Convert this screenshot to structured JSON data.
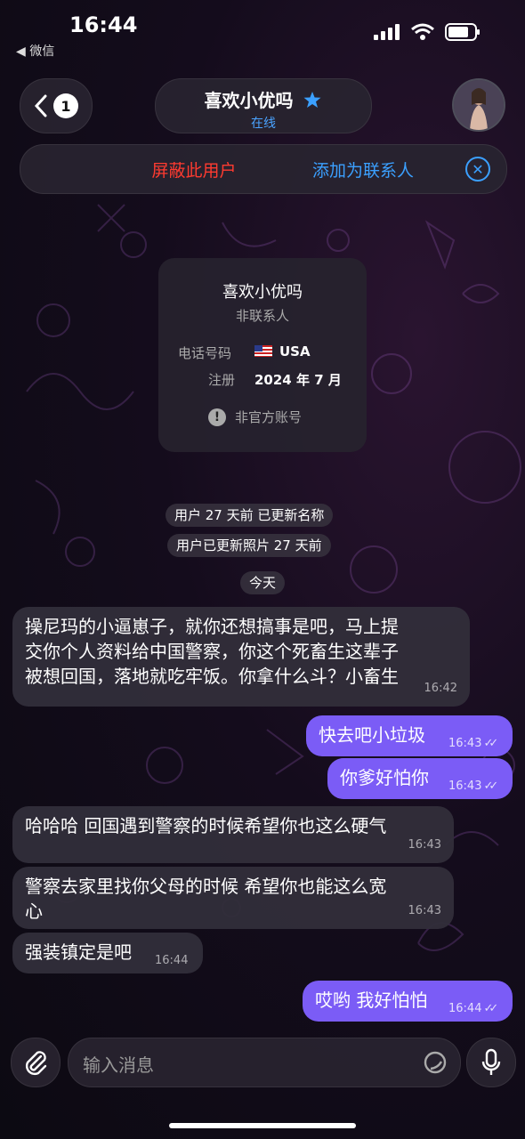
{
  "status_bar": {
    "time": "16:44",
    "back_app": "◀ 微信"
  },
  "header": {
    "back_badge": "1",
    "name": "喜欢小优吗",
    "status": "在线"
  },
  "action_bar": {
    "block": "屏蔽此用户",
    "add_contact": "添加为联系人"
  },
  "info_card": {
    "name": "喜欢小优吗",
    "subtitle": "非联系人",
    "phone_label": "电话号码",
    "phone_value": "USA",
    "registered_label": "注册",
    "registered_value": "2024 年 7 月",
    "unofficial": "非官方账号"
  },
  "system_messages": {
    "name_updated": "用户 27 天前 已更新名称",
    "photo_updated": "用户已更新照片 27 天前",
    "today": "今天"
  },
  "messages": [
    {
      "direction": "in",
      "lines": [
        "操尼玛的小逼崽子，就你还想搞事是吧，马上提",
        "交你个人资料给中国警察，你这个死畜生这辈子",
        "被想回国，落地就吃牢饭。你拿什么斗？小畜生"
      ],
      "time": "16:42"
    },
    {
      "direction": "out",
      "text": "快去吧小垃圾",
      "time": "16:43"
    },
    {
      "direction": "out",
      "text": "你爹好怕你",
      "time": "16:43"
    },
    {
      "direction": "in",
      "text": "哈哈哈 回国遇到警察的时候希望你也这么硬气",
      "time": "16:43"
    },
    {
      "direction": "in",
      "lines": [
        "警察去家里找你父母的时候 希望你也能这么宽",
        "心"
      ],
      "time": "16:43"
    },
    {
      "direction": "in",
      "text": "强装镇定是吧",
      "time": "16:44"
    },
    {
      "direction": "out",
      "text": "哎哟 我好怕怕",
      "time": "16:44"
    }
  ],
  "input": {
    "placeholder": "输入消息"
  },
  "colors": {
    "accent": "#3ba0ff",
    "danger": "#ff3b30",
    "outgoing_bubble": "#7b5cf6",
    "incoming_bubble": "#322e3a"
  }
}
